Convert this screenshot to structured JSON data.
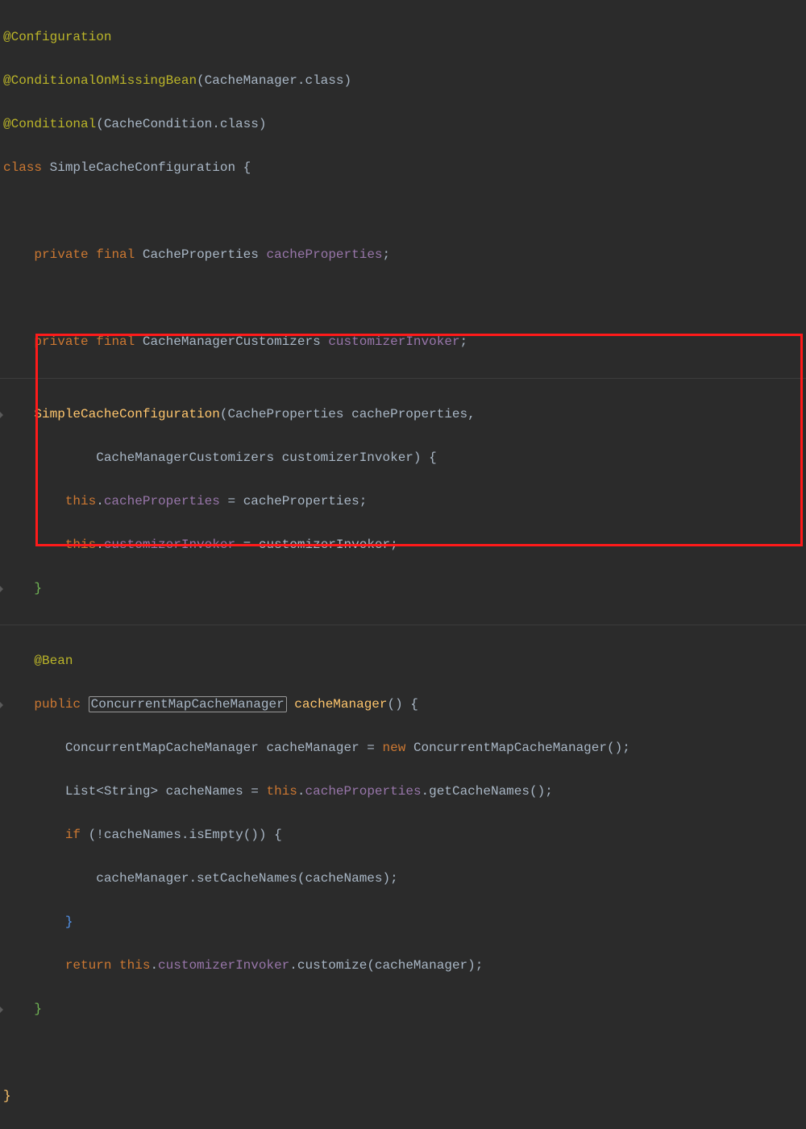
{
  "code": {
    "l1_annot": "@Configuration",
    "l2_annot": "@ConditionalOnMissingBean",
    "l2_arg_type": "CacheManager",
    "l2_arg_suffix": ".class",
    "l3_annot": "@Conditional",
    "l3_arg_type": "CacheCondition",
    "l3_arg_suffix": ".class",
    "l4_kw_class": "class",
    "l4_name": "SimpleCacheConfiguration",
    "l4_brace": " {",
    "l6_private": "private",
    "l6_final": "final",
    "l6_type": "CacheProperties",
    "l6_name": "cacheProperties",
    "l8_type": "CacheManagerCustomizers",
    "l8_name": "customizerInvoker",
    "l10_ctor": "SimpleCacheConfiguration",
    "l10_p1_type": "CacheProperties",
    "l10_p1_name": "cacheProperties",
    "l11_p2_type": "CacheManagerCustomizers",
    "l11_p2_name": "customizerInvoker",
    "l11_brace": ") {",
    "l12_this": "this",
    "l12_field": "cacheProperties",
    "l12_rhs": "cacheProperties",
    "l13_field": "customizerInvoker",
    "l13_rhs": "customizerInvoker",
    "l14_close": "}",
    "l16_annot": "@Bean",
    "l17_public": "public",
    "l17_rettype": "ConcurrentMapCacheManager",
    "l17_method": "cacheManager",
    "l17_sig": "() {",
    "l18_type": "ConcurrentMapCacheManager",
    "l18_var": "cacheManager",
    "l18_new": "new",
    "l18_ctor": "ConcurrentMapCacheManager",
    "l19_list": "List",
    "l19_gen": "String",
    "l19_var": "cacheNames",
    "l19_this": "this",
    "l19_field": "cacheProperties",
    "l19_call": "getCacheNames",
    "l20_if": "if",
    "l20_not": "!",
    "l20_var": "cacheNames",
    "l20_call": "isEmpty",
    "l21_var": "cacheManager",
    "l21_call": "setCacheNames",
    "l21_arg": "cacheNames",
    "l22_close": "}",
    "l23_return": "return",
    "l23_this": "this",
    "l23_field": "customizerInvoker",
    "l23_call": "customize",
    "l23_arg": "cacheManager",
    "l24_close": "}",
    "l26_close": "}"
  }
}
